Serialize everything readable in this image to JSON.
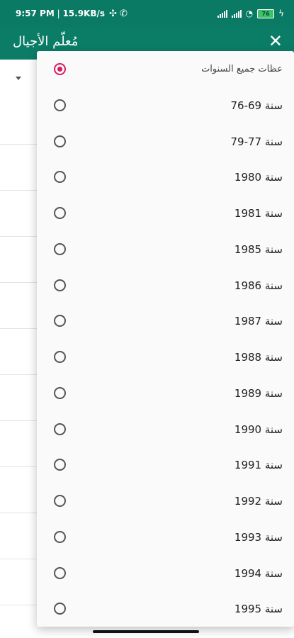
{
  "status_bar": {
    "time": "9:57 PM",
    "speed": "15.9KB/s",
    "battery": "76"
  },
  "app_bar": {
    "title": "مُعلّم الأجيال",
    "close_icon": "close-icon"
  },
  "menu": {
    "options": [
      {
        "label": "عظات جميع السنوات",
        "checked": true
      },
      {
        "label": "سنة 69-76",
        "checked": false
      },
      {
        "label": "سنة 77-79",
        "checked": false
      },
      {
        "label": "سنة 1980",
        "checked": false
      },
      {
        "label": "سنة 1981",
        "checked": false
      },
      {
        "label": "سنة 1985",
        "checked": false
      },
      {
        "label": "سنة 1986",
        "checked": false
      },
      {
        "label": "سنة 1987",
        "checked": false
      },
      {
        "label": "سنة 1988",
        "checked": false
      },
      {
        "label": "سنة 1989",
        "checked": false
      },
      {
        "label": "سنة 1990",
        "checked": false
      },
      {
        "label": "سنة 1991",
        "checked": false
      },
      {
        "label": "سنة 1992",
        "checked": false
      },
      {
        "label": "سنة 1993",
        "checked": false
      },
      {
        "label": "سنة 1994",
        "checked": false
      },
      {
        "label": "سنة 1995",
        "checked": false
      }
    ]
  },
  "colors": {
    "app_bar": "#0b7d67",
    "accent": "#d81b60"
  }
}
